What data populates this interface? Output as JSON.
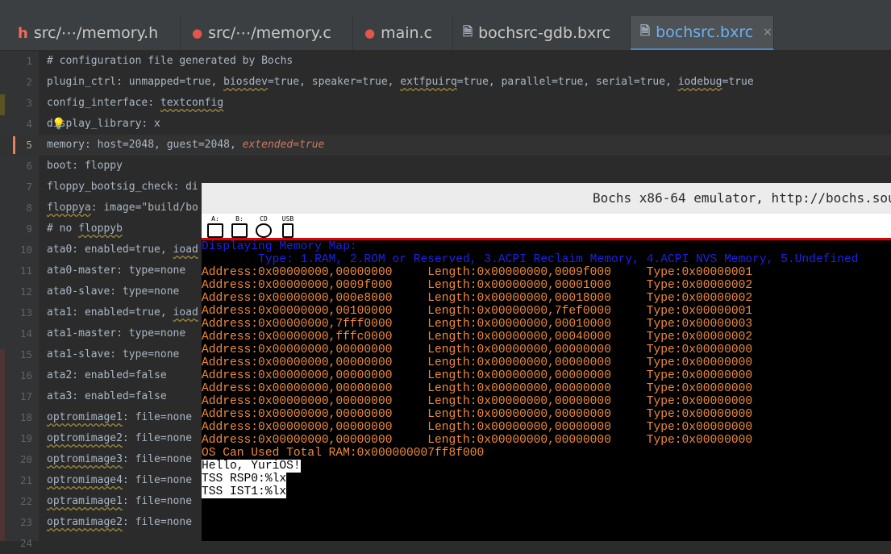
{
  "tabs": [
    {
      "label": "src/⋯/memory.h",
      "icon": "h-header-icon"
    },
    {
      "label": "src/⋯/memory.c",
      "icon": "c-file-icon"
    },
    {
      "label": "main.c",
      "icon": "c-file-icon"
    },
    {
      "label": "bochsrc-gdb.bxrc",
      "icon": "file-icon"
    },
    {
      "label": "bochsrc.bxrc",
      "icon": "file-icon",
      "close": "×"
    }
  ],
  "editor": {
    "line_numbers": [
      "1",
      "2",
      "3",
      "4",
      "5",
      "6",
      "7",
      "8",
      "9",
      "10",
      "11",
      "12",
      "13",
      "14",
      "15",
      "16",
      "17",
      "18",
      "19",
      "20",
      "21",
      "22",
      "23",
      "24"
    ],
    "lines": {
      "l1": "# configuration file generated by Bochs",
      "l2a": "plugin_ctrl: unmapped=true, ",
      "l2b": "biosdev",
      "l2c": "=true, speaker=true, ",
      "l2d": "extfpuirq",
      "l2e": "=true, parallel=true, serial=true, ",
      "l2f": "iodebug",
      "l2g": "=true",
      "l3a": "config_interface: ",
      "l3b": "textconfig",
      "l4": "display_library: x",
      "l5a": "memory: host=2048, guest=2048, ",
      "l5b": "extended=true",
      "l6": "boot: floppy",
      "l7": "floppy_bootsig_check: di",
      "l8a": "floppya",
      "l8b": ": image=\"build/bo",
      "l9a": "# no ",
      "l9b": "floppyb",
      "l10a": "ata0: enabled=true, ",
      "l10b": "ioad",
      "l11": "ata0-master: type=none",
      "l12": "ata0-slave: type=none",
      "l13a": "ata1: enabled=true, ",
      "l13b": "ioad",
      "l14": "ata1-master: type=none",
      "l15": "ata1-slave: type=none",
      "l16": "ata2: enabled=false",
      "l17": "ata3: enabled=false",
      "l18a": "optromimage1",
      "l18b": ": file=none",
      "l19a": "optromimage2",
      "l19b": ": file=none",
      "l20a": "optromimage3",
      "l20b": ": file=none",
      "l21a": "optromimage4",
      "l21b": ": file=none",
      "l22a": "optramimage1",
      "l22b": ": file=none",
      "l23a": "optramimage2",
      "l23b": ": file=none"
    }
  },
  "bochs": {
    "title": "Bochs x86-64 emulator, http://bochs.sourc",
    "toolbar": [
      "A:",
      "B:",
      "CD",
      "USB"
    ],
    "screen": {
      "header": "Displaying Memory Map:",
      "types": "        Type: 1.RAM, 2.ROM or Reserved, 3.ACPI Reclaim Memory, 4.ACPI NVS Memory, 5.Undefined",
      "rows": [
        "Address:0x00000000,00000000     Length:0x00000000,0009f000     Type:0x00000001",
        "Address:0x00000000,0009f000     Length:0x00000000,00001000     Type:0x00000002",
        "Address:0x00000000,000e8000     Length:0x00000000,00018000     Type:0x00000002",
        "Address:0x00000000,00100000     Length:0x00000000,7fef0000     Type:0x00000001",
        "Address:0x00000000,7fff0000     Length:0x00000000,00010000     Type:0x00000003",
        "Address:0x00000000,fffc0000     Length:0x00000000,00040000     Type:0x00000002",
        "Address:0x00000000,00000000     Length:0x00000000,00000000     Type:0x00000000",
        "Address:0x00000000,00000000     Length:0x00000000,00000000     Type:0x00000000",
        "Address:0x00000000,00000000     Length:0x00000000,00000000     Type:0x00000000",
        "Address:0x00000000,00000000     Length:0x00000000,00000000     Type:0x00000000",
        "Address:0x00000000,00000000     Length:0x00000000,00000000     Type:0x00000000",
        "Address:0x00000000,00000000     Length:0x00000000,00000000     Type:0x00000000",
        "Address:0x00000000,00000000     Length:0x00000000,00000000     Type:0x00000000",
        "Address:0x00000000,00000000     Length:0x00000000,00000000     Type:0x00000000"
      ],
      "total": "OS Can Used Total RAM:0x000000007ff8f000",
      "hello": "Hello, YuriOS!",
      "rsp0": "TSS RSP0:%lx",
      "ist1": "TSS IST1:%lx"
    }
  }
}
